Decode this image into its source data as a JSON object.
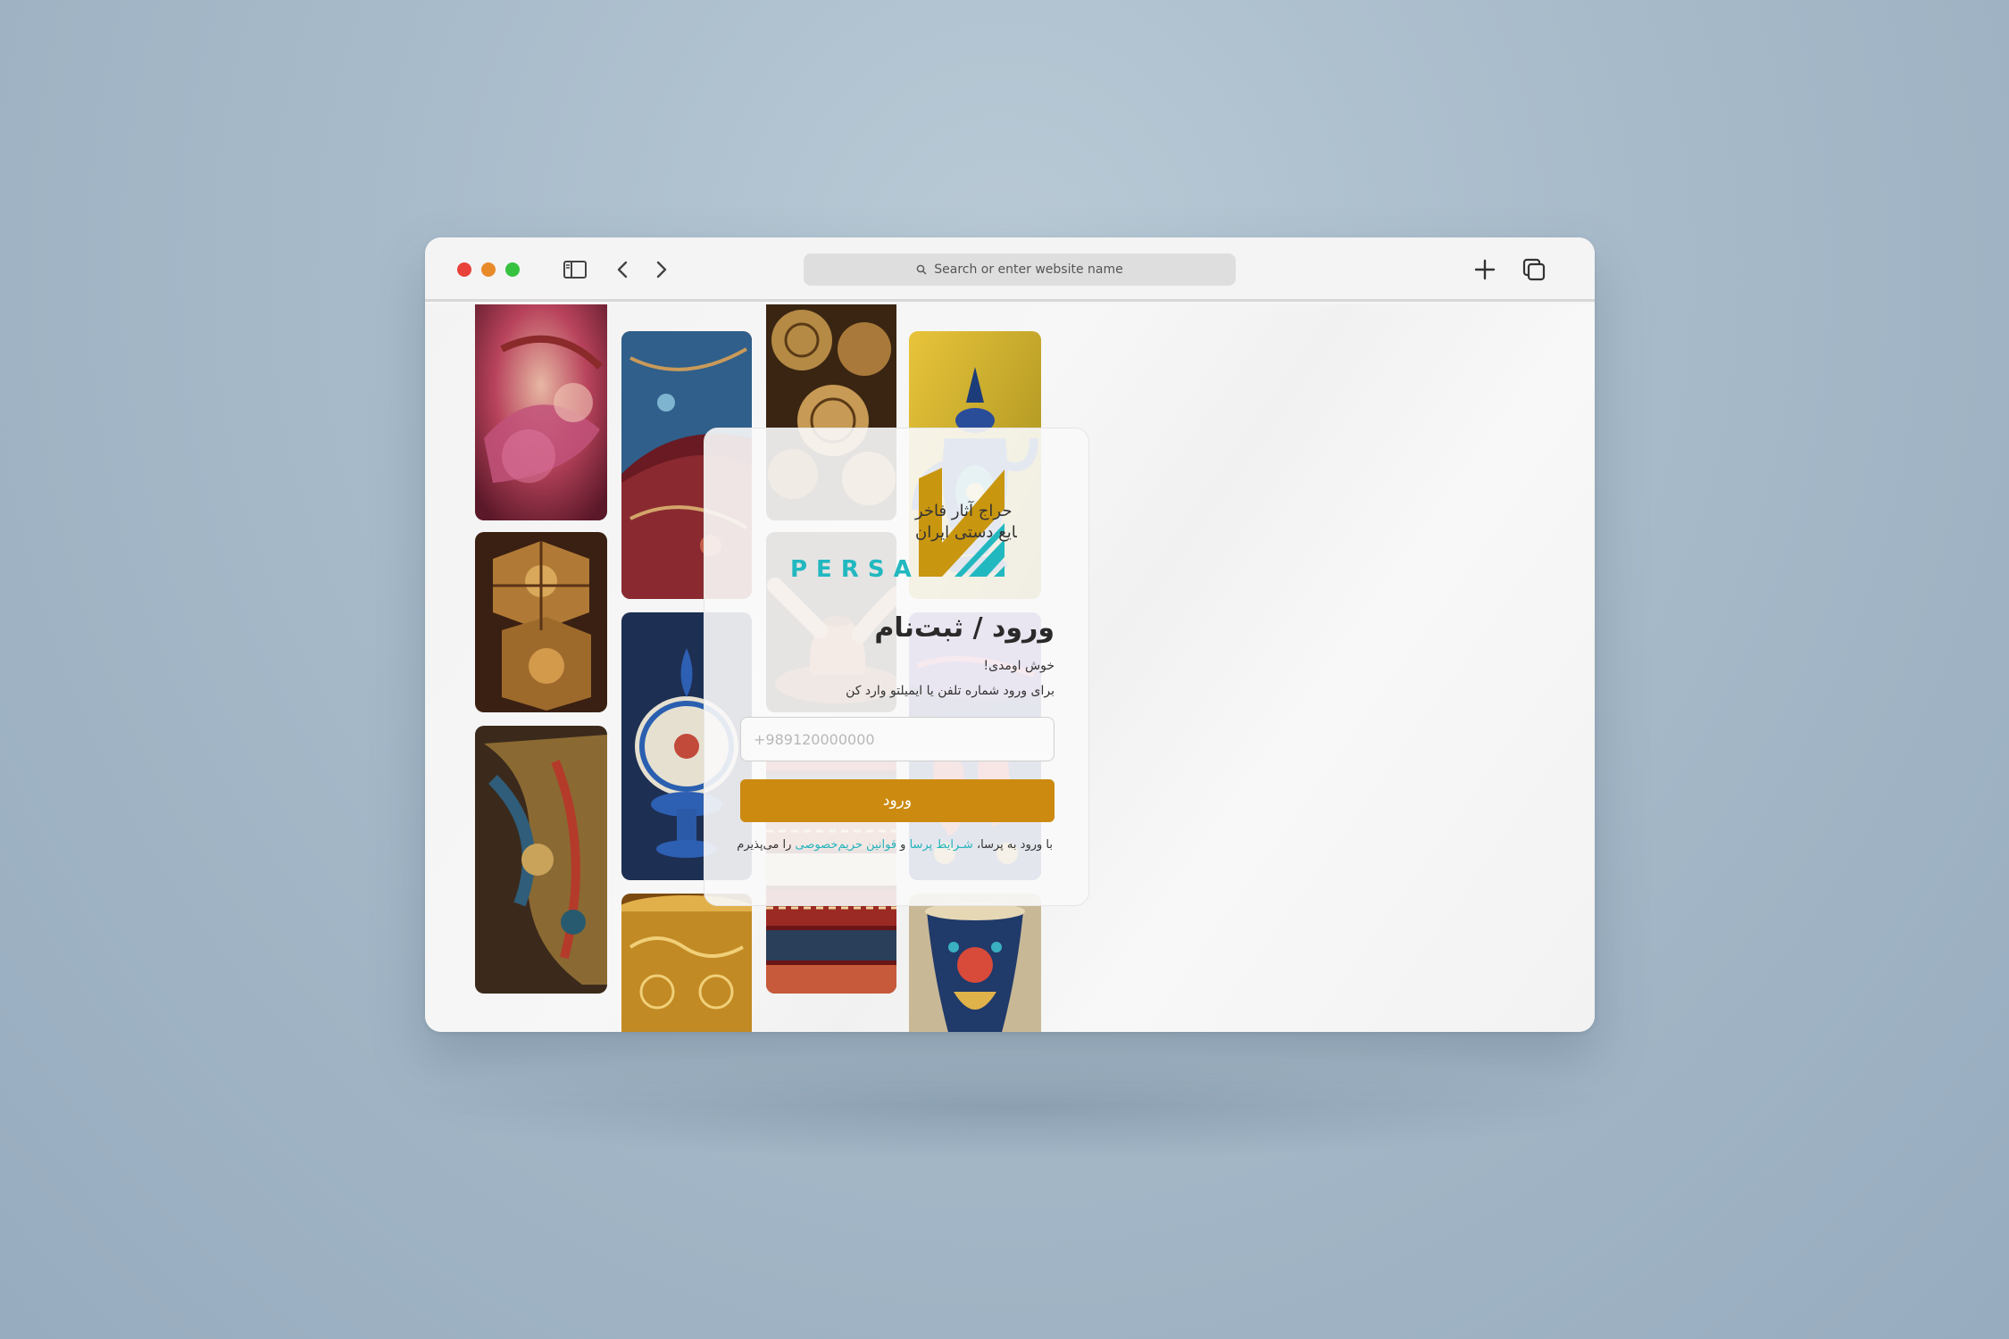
{
  "browser": {
    "address_placeholder": "Search or enter website name"
  },
  "gallery": {
    "tiles": [
      "embroidered-slippers",
      "wooden-khatam-boxes",
      "woven-carpet-roll",
      "termeh-fabric",
      "minakari-dish",
      "golden-engraved-bowl",
      "brass-plates-shop",
      "pottery-wheel",
      "stacked-rugs",
      "enamel-teapot",
      "red-shoes-on-carpet",
      "painted-vase"
    ]
  },
  "logo": {
    "tagline_line1": "اولین حراج آثار فاخر",
    "tagline_line2": "صنایع دستی ایران",
    "brand": "PERSA",
    "colors": {
      "gold": "#c9960f",
      "teal": "#22b8c0"
    }
  },
  "login": {
    "title": "ورود / ثبت‌نام",
    "welcome": "خوش اومدی!",
    "hint": "برای ورود شماره تلفن یا ایمیلتو وارد کن",
    "phone_placeholder": "+989120000000",
    "submit_label": "ورود",
    "terms_prefix": "با ورود به پرسا، ",
    "terms_link1": "شـرایط پرسا",
    "terms_and": " و ",
    "terms_link2": "قوانین حریم‌خصوصی",
    "terms_suffix": " را می‌پذیرم",
    "accent_color": "#cc8a10"
  }
}
